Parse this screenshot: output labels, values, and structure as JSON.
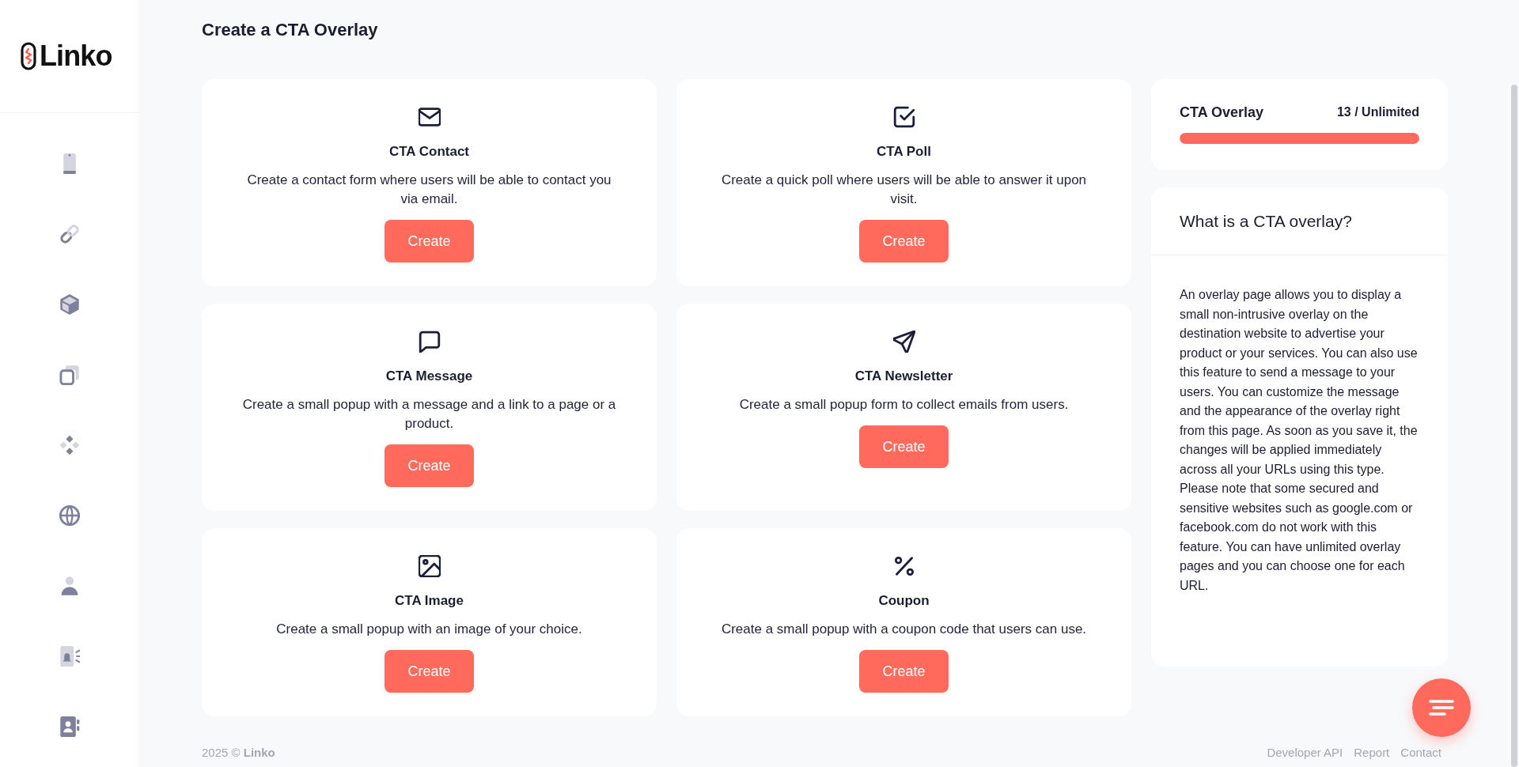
{
  "sidebar": {
    "logo": "Linko"
  },
  "page": {
    "title": "Create a CTA Overlay"
  },
  "cards": [
    {
      "title": "CTA Contact",
      "description": "Create a contact form where users will be able to contact you via email.",
      "button": "Create"
    },
    {
      "title": "CTA Poll",
      "description": "Create a quick poll where users will be able to answer it upon visit.",
      "button": "Create"
    },
    {
      "title": "CTA Message",
      "description": "Create a small popup with a message and a link to a page or a product.",
      "button": "Create"
    },
    {
      "title": "CTA Newsletter",
      "description": "Create a small popup form to collect emails from users.",
      "button": "Create"
    },
    {
      "title": "CTA Image",
      "description": "Create a small popup with an image of your choice.",
      "button": "Create"
    },
    {
      "title": "Coupon",
      "description": "Create a small popup with a coupon code that users can use.",
      "button": "Create"
    }
  ],
  "usage": {
    "title": "CTA Overlay",
    "count": "13 / Unlimited",
    "level": 1
  },
  "info": {
    "title": "What is a CTA overlay?",
    "body": "An overlay page allows you to display a small non-intrusive overlay on the destination website to advertise your product or your services. You can also use this feature to send a message to your users. You can customize the message and the appearance of the overlay right from this page. As soon as you save it, the changes will be applied immediately across all your URLs using this type. Please note that some secured and sensitive websites such as google.com or facebook.com do not work with this feature. You can have unlimited overlay pages and you can choose one for each URL."
  },
  "footer": {
    "copyright": "2025 © **Linko**",
    "links": [
      "Developer API",
      "Report",
      "Contact"
    ]
  }
}
